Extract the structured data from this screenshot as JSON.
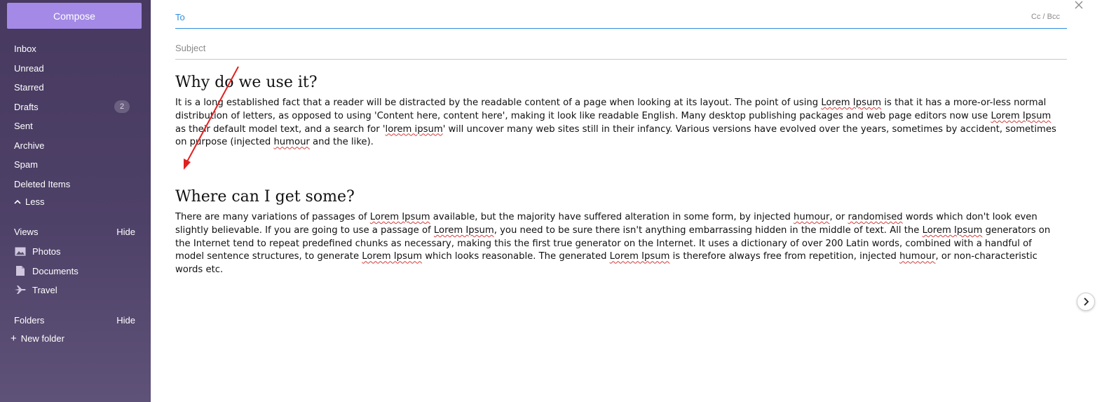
{
  "sidebar": {
    "compose_label": "Compose",
    "folders": [
      {
        "label": "Inbox",
        "badge": ""
      },
      {
        "label": "Unread",
        "badge": ""
      },
      {
        "label": "Starred",
        "badge": ""
      },
      {
        "label": "Drafts",
        "badge": "2"
      },
      {
        "label": "Sent",
        "badge": ""
      },
      {
        "label": "Archive",
        "badge": ""
      },
      {
        "label": "Spam",
        "badge": ""
      },
      {
        "label": "Deleted Items",
        "badge": ""
      }
    ],
    "less_label": "Less",
    "views": {
      "title": "Views",
      "hide_label": "Hide",
      "items": [
        {
          "label": "Photos",
          "icon": "photo-icon"
        },
        {
          "label": "Documents",
          "icon": "document-icon"
        },
        {
          "label": "Travel",
          "icon": "airplane-icon"
        }
      ]
    },
    "folders_section": {
      "title": "Folders",
      "hide_label": "Hide",
      "new_folder_label": "New folder"
    }
  },
  "compose": {
    "to_label": "To",
    "cc_bcc_label": "Cc / Bcc",
    "subject_placeholder": "Subject",
    "close_icon": "close-icon"
  },
  "body": {
    "heading1": "Why do we use it?",
    "para1_parts": [
      "It is a long established fact that a reader will be distracted by the readable content of a page when looking at its layout. The point of using ",
      "Lorem Ipsum",
      " is that it has a more-or-less normal distribution of letters, as opposed to using 'Content here, content here', making it look like readable English. Many desktop publishing packages and web page editors now use ",
      "Lorem Ipsum",
      " as their default model text, and a search for '",
      "lorem ipsum",
      "' will uncover many web sites still in their infancy. Various versions have evolved over the years, sometimes by accident, sometimes on purpose (injected ",
      "humour",
      " and the like)."
    ],
    "heading2": "Where can I get some?",
    "para2_parts": [
      "There are many variations of passages of ",
      "Lorem Ipsum",
      " available, but the majority have suffered alteration in some form, by injected ",
      "humour",
      ", or ",
      "randomised",
      " words which don't look even slightly believable. If you are going to use a passage of ",
      "Lorem Ipsum",
      ", you need to be sure there isn't anything embarrassing hidden in the middle of text. All the ",
      "Lorem Ipsum",
      " generators on the Internet tend to repeat predefined chunks as necessary, making this the first true generator on the Internet. It uses a dictionary of over 200 Latin words, combined with a handful of model sentence structures, to generate ",
      "Lorem Ipsum",
      " which looks reasonable. The generated ",
      "Lorem Ipsum",
      " is therefore always free from repetition, injected ",
      "humour",
      ", or non-characteristic words etc."
    ]
  },
  "colors": {
    "accent": "#2f8fdd",
    "compose_button": "#a48ae6",
    "sidebar_bg": "#47395f",
    "annotation_arrow": "#e02020",
    "spellcheck_underline": "#d63b3b"
  },
  "expand_icon": "chevron-right-icon"
}
